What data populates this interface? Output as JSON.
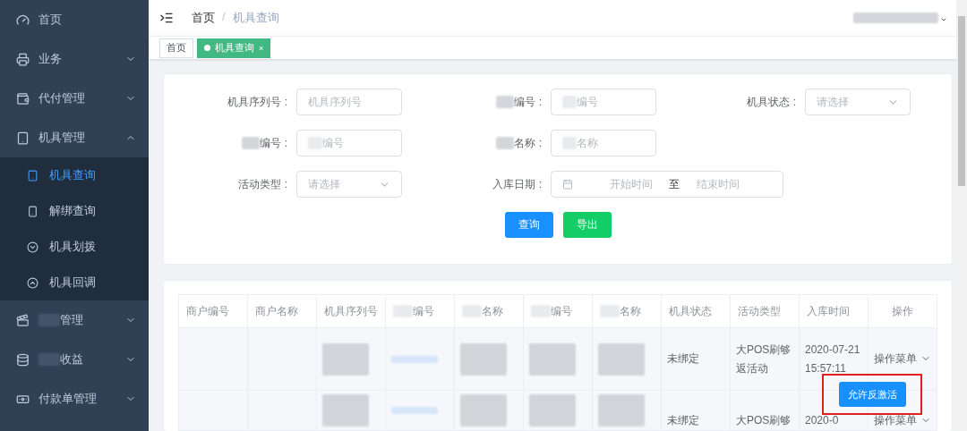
{
  "sidebar": {
    "items": [
      {
        "label": "首页",
        "redacted_prefix": false
      },
      {
        "label": "业务",
        "redacted_prefix": false,
        "expandable": true,
        "expanded": false
      },
      {
        "label": "代付管理",
        "redacted_prefix": false,
        "expandable": true,
        "expanded": false
      },
      {
        "label": "机具管理",
        "redacted_prefix": false,
        "expandable": true,
        "expanded": true,
        "children": [
          {
            "label": "机具查询",
            "selected": true
          },
          {
            "label": "解绑查询",
            "selected": false
          },
          {
            "label": "机具划拨",
            "selected": false
          },
          {
            "label": "机具回调",
            "selected": false
          }
        ]
      },
      {
        "label": "管理",
        "redacted_prefix": true,
        "expandable": true,
        "expanded": false
      },
      {
        "label": "收益",
        "redacted_prefix": true,
        "expandable": true,
        "expanded": false
      },
      {
        "label": "付款单管理",
        "redacted_prefix": false,
        "expandable": true,
        "expanded": false
      }
    ]
  },
  "breadcrumb": [
    "首页",
    "机具查询"
  ],
  "breadcrumb_separator": "/",
  "user": {
    "redacted": true
  },
  "tabs": [
    {
      "label": "首页",
      "selected": false
    },
    {
      "label": "机具查询",
      "selected": true,
      "close": "×"
    }
  ],
  "filters": [
    {
      "kind": "input",
      "label": "机具序列号 :",
      "label_redacted": false,
      "placeholder": "机具序列号",
      "placeholder_redacted": false
    },
    {
      "kind": "input",
      "label": "编号 :",
      "label_redacted": true,
      "placeholder": "编号",
      "placeholder_redacted": true
    },
    {
      "kind": "select",
      "label": "机具状态 :",
      "label_redacted": false,
      "placeholder": "请选择"
    },
    {
      "kind": "input",
      "label": "编号 :",
      "label_redacted": true,
      "placeholder": "编号",
      "placeholder_redacted": true
    },
    {
      "kind": "input",
      "label": "名称 :",
      "label_redacted": true,
      "placeholder": "名称",
      "placeholder_redacted": true
    },
    {
      "kind": "blank"
    },
    {
      "kind": "select",
      "label": "活动类型 :",
      "label_redacted": false,
      "placeholder": "请选择"
    },
    {
      "kind": "daterange",
      "label": "入库日期 :",
      "label_redacted": false,
      "start_placeholder": "开始时间",
      "separator": "至",
      "end_placeholder": "结束时间"
    }
  ],
  "buttons": [
    {
      "kind": "primary",
      "label": "查询"
    },
    {
      "kind": "success",
      "label": "导出"
    }
  ],
  "table": {
    "columns": [
      {
        "label": "商户编号",
        "redacted_prefix": false
      },
      {
        "label": "商户名称",
        "redacted_prefix": false
      },
      {
        "label": "机具序列号",
        "redacted_prefix": false
      },
      {
        "label": "编号",
        "redacted_prefix": true
      },
      {
        "label": "名称",
        "redacted_prefix": true
      },
      {
        "label": "编号",
        "redacted_prefix": true
      },
      {
        "label": "名称",
        "redacted_prefix": true
      },
      {
        "label": "机具状态",
        "redacted_prefix": false
      },
      {
        "label": "活动类型",
        "redacted_prefix": false
      },
      {
        "label": "入库时间",
        "redacted_prefix": false
      },
      {
        "label": "操作",
        "redacted_prefix": false
      }
    ],
    "rows": [
      {
        "cells": [
          {
            "kind": "empty"
          },
          {
            "kind": "empty"
          },
          {
            "kind": "redacted"
          },
          {
            "kind": "redacted-link"
          },
          {
            "kind": "redacted"
          },
          {
            "kind": "redacted"
          },
          {
            "kind": "redacted"
          },
          {
            "kind": "text",
            "text": "未绑定"
          },
          {
            "kind": "text",
            "text": "大POS刷够返活动"
          },
          {
            "kind": "text",
            "text": "2020-07-21 15:57:11"
          },
          {
            "kind": "menu",
            "text": "操作菜单"
          }
        ]
      },
      {
        "cells": [
          {
            "kind": "empty"
          },
          {
            "kind": "empty"
          },
          {
            "kind": "redacted"
          },
          {
            "kind": "redacted-link"
          },
          {
            "kind": "redacted"
          },
          {
            "kind": "redacted"
          },
          {
            "kind": "redacted"
          },
          {
            "kind": "text",
            "text": "未绑定"
          },
          {
            "kind": "text",
            "text": "大POS刷够"
          },
          {
            "kind": "text",
            "text": "2020-0"
          },
          {
            "kind": "menu",
            "text": "操作菜单"
          }
        ]
      }
    ]
  },
  "popup": {
    "button": "允许反激活",
    "highlighted": true
  }
}
